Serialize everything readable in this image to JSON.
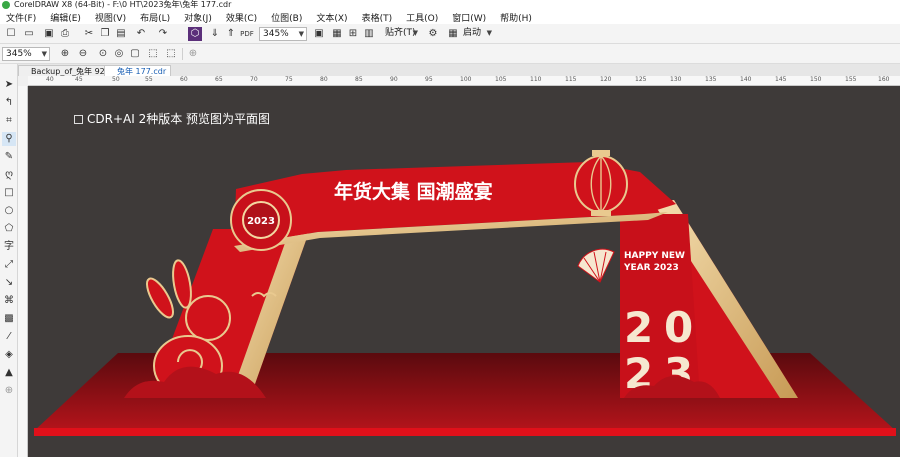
{
  "window": {
    "title": "CorelDRAW X8 (64-Bit) - F:\\0 HT\\2023兔年\\兔年 177.cdr"
  },
  "menu": [
    "文件(F)",
    "编辑(E)",
    "视图(V)",
    "布局(L)",
    "对象(J)",
    "效果(C)",
    "位图(B)",
    "文本(X)",
    "表格(T)",
    "工具(O)",
    "窗口(W)",
    "帮助(H)"
  ],
  "toolbar": {
    "zoom_value": "345%",
    "snap_label": "贴齐(T)",
    "launch_label": "启动"
  },
  "propbar": {
    "zoom_value": "345%"
  },
  "tabs": [
    {
      "label": "Backup_of_兔年 92.cdr",
      "active": false
    },
    {
      "label": "兔年 177.cdr",
      "active": true
    }
  ],
  "ruler": {
    "ticks": [
      "40",
      "45",
      "50",
      "55",
      "60",
      "65",
      "70",
      "75",
      "80",
      "85",
      "90",
      "95",
      "100",
      "105",
      "110",
      "115",
      "120",
      "125",
      "130",
      "135",
      "140",
      "145",
      "150",
      "155",
      "160"
    ]
  },
  "canvas": {
    "note": "CDR+AI 2种版本   预览图为平面图",
    "design": {
      "banner_text": "年货大集 国潮盛宴",
      "badge_text": "2023",
      "happy_new": "HAPPY NEW",
      "year_text": "YEAR 2023",
      "big_digits": [
        "2",
        "0",
        "2",
        "3"
      ]
    }
  },
  "colors": {
    "canvas_bg": "#3e3a39",
    "brand_red": "#d0121b",
    "gold": "#e9c98f",
    "dark_red": "#7a0a10"
  }
}
